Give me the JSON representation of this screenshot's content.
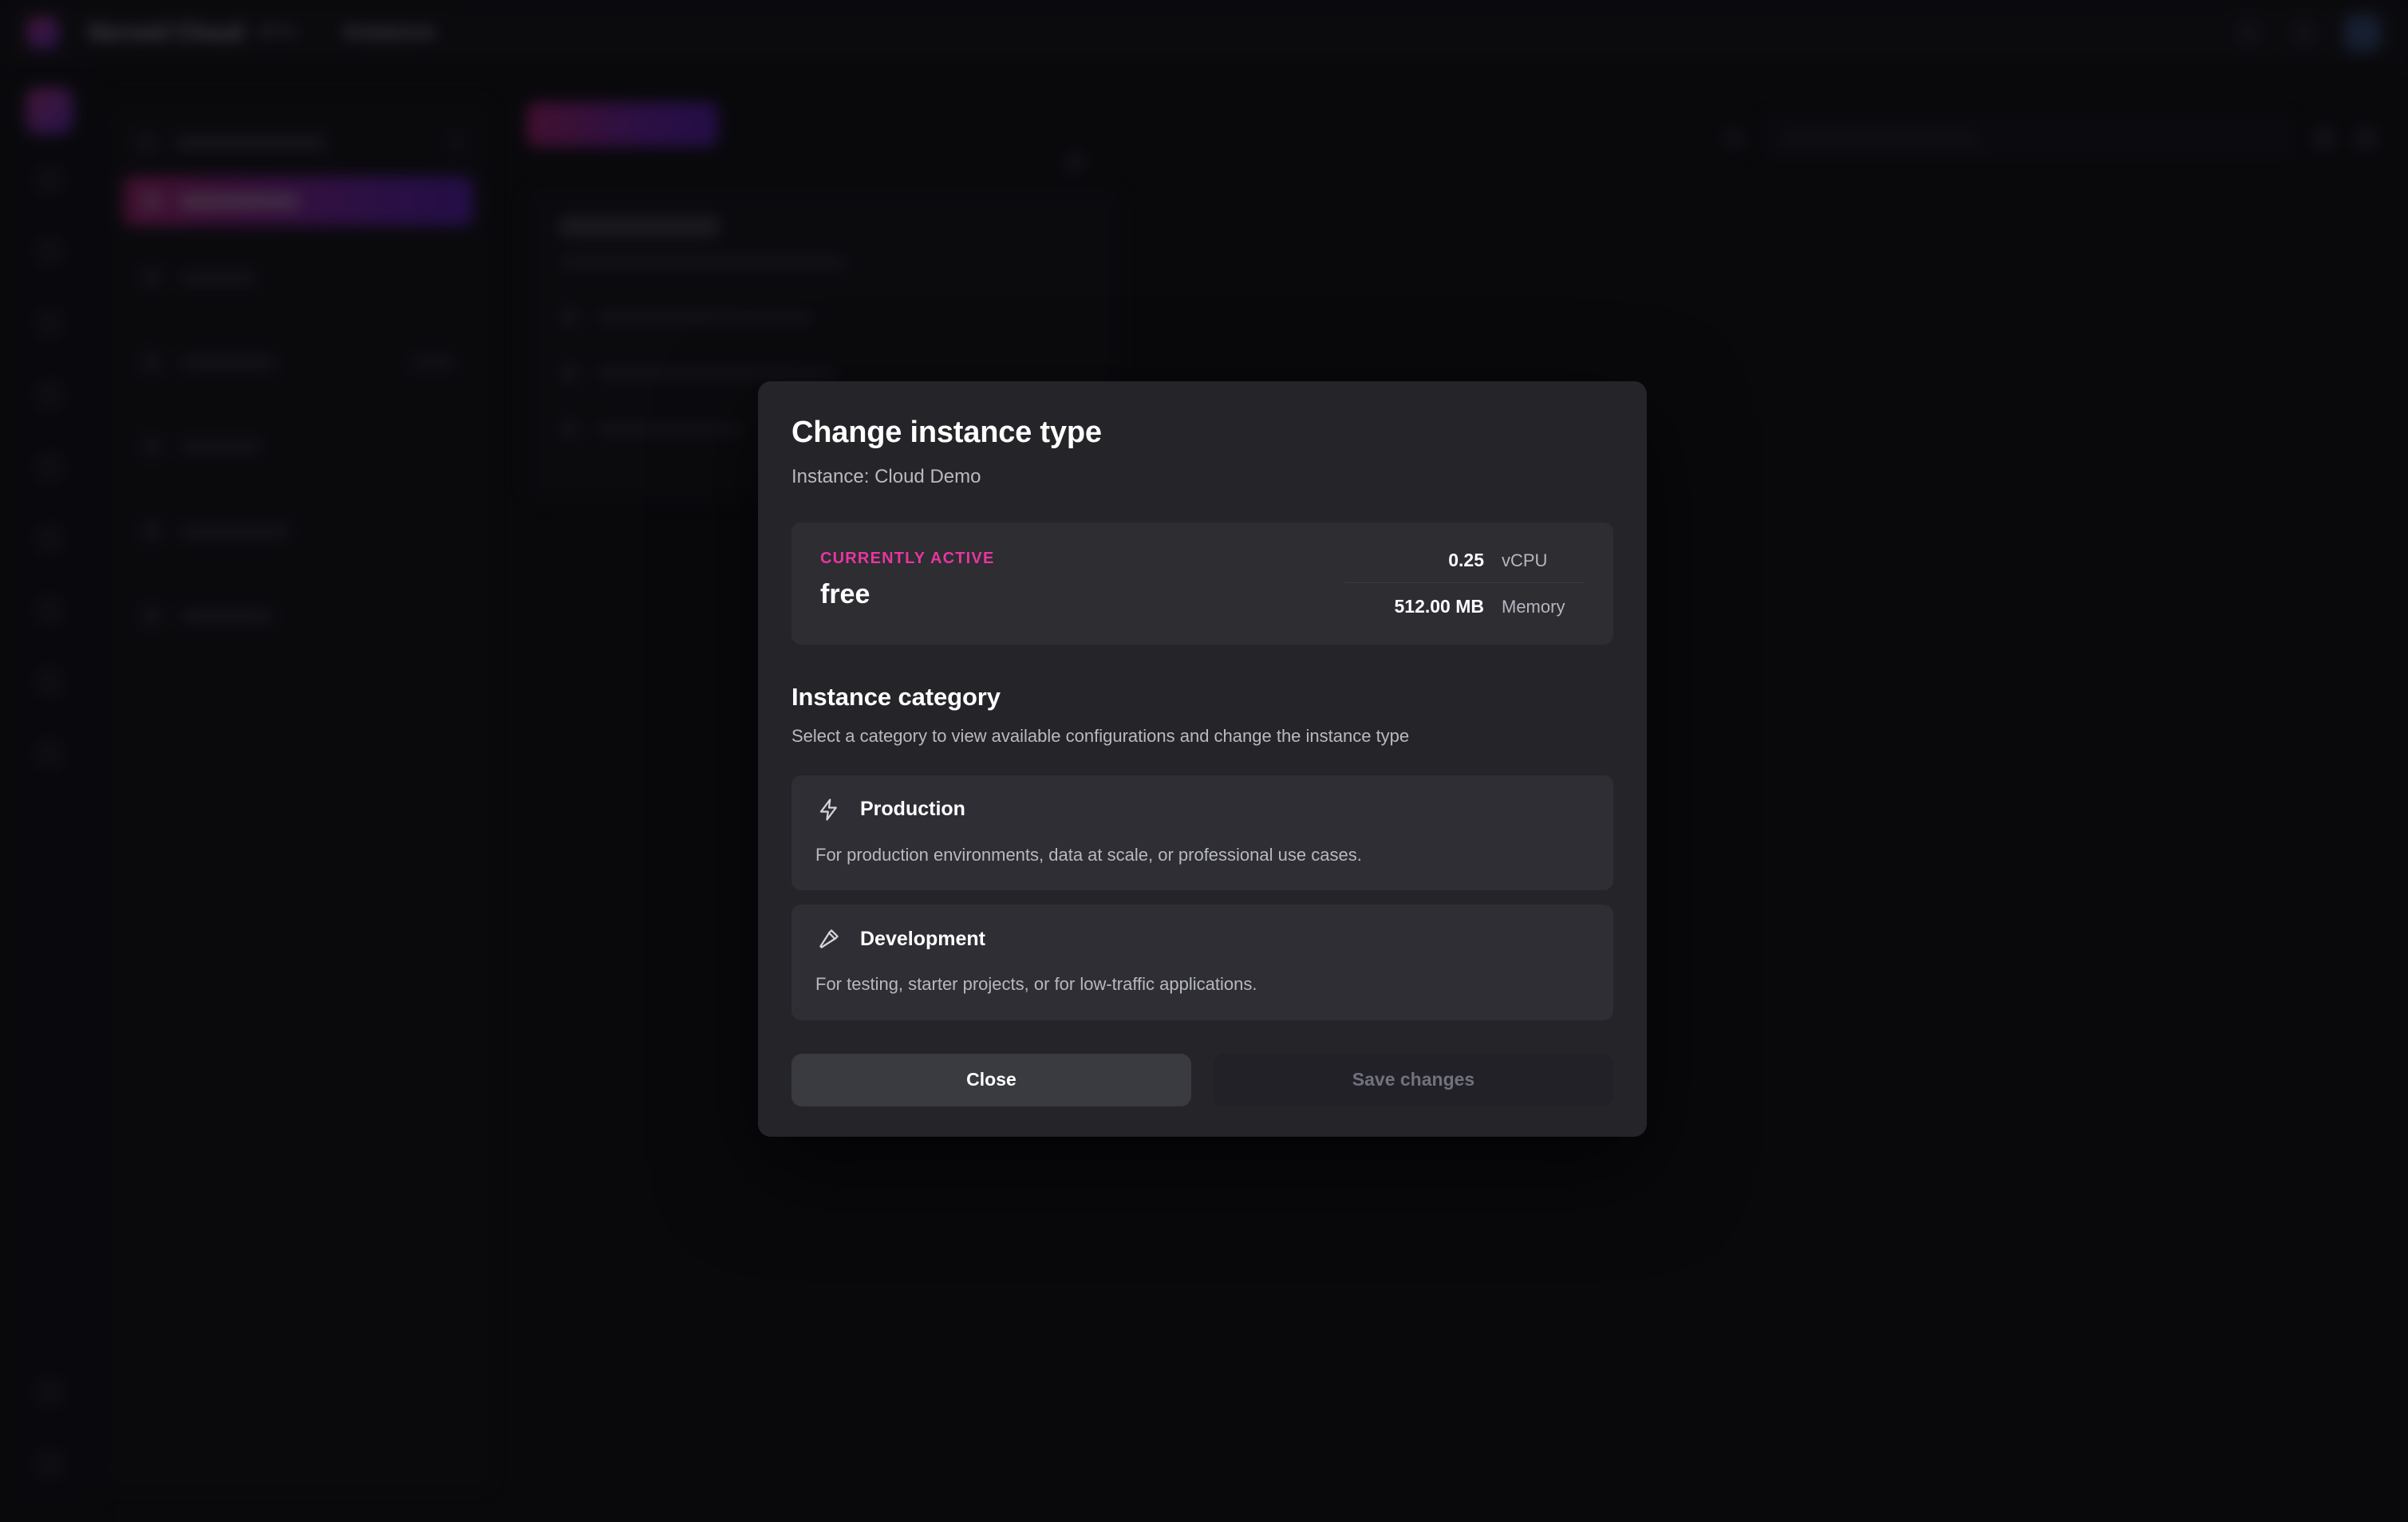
{
  "app": {
    "brand_name": "Served Cloud",
    "brand_badge": "BETA",
    "breadcrumb_current": "Instances"
  },
  "sidebar_rail": {
    "logo": "workspace-logo",
    "icons": [
      "home-icon",
      "grid-icon",
      "database-icon",
      "layers-icon",
      "shield-icon",
      "key-icon",
      "server-icon",
      "chart-icon",
      "bell-icon"
    ],
    "bottom_icons": [
      "help-icon",
      "settings-icon"
    ]
  },
  "sidebar_panel": {
    "header_label": "Workspace",
    "items": [
      {
        "label": "Instances",
        "active": true,
        "badge": ""
      },
      {
        "label": "Billing",
        "active": false,
        "badge": ""
      },
      {
        "label": "Network",
        "active": false,
        "badge": "BETA"
      },
      {
        "label": "Logs",
        "active": false,
        "badge": ""
      },
      {
        "label": "Members",
        "active": false,
        "badge": ""
      },
      {
        "label": "Settings",
        "active": false,
        "badge": ""
      }
    ]
  },
  "toolbar": {
    "primary_button_label": "New instance",
    "search_placeholder": "Search instances",
    "search_value": "",
    "search_icon": "search-icon",
    "filter_icon": "filter-icon",
    "view_icon": "grid-view-icon"
  },
  "content": {
    "card_title": "Cloud Demo",
    "card_subtitle": "Running on shared infrastructure",
    "rows": [
      {
        "label": "High CPU instance"
      },
      {
        "label": "EMEA Endpoint Cluster"
      },
      {
        "label": "v10.4.202-2.12"
      }
    ],
    "menu_icon": "kebab-menu-icon"
  },
  "modal": {
    "title": "Change instance type",
    "subtitle": "Instance: Cloud Demo",
    "active_card": {
      "kicker": "CURRENTLY ACTIVE",
      "name": "free",
      "specs": [
        {
          "value": "0.25",
          "unit": "vCPU"
        },
        {
          "value": "512.00 MB",
          "unit": "Memory"
        }
      ]
    },
    "section": {
      "title": "Instance category",
      "subtitle": "Select a category to view available configurations and change the instance type"
    },
    "categories": [
      {
        "icon": "zap-icon",
        "name": "Production",
        "description": "For production environments, data at scale, or professional use cases."
      },
      {
        "icon": "hammer-icon",
        "name": "Development",
        "description": "For testing, starter projects, or for low-traffic applications."
      }
    ],
    "buttons": {
      "close_label": "Close",
      "save_label": "Save changes"
    }
  },
  "colors": {
    "accent_pink": "#e8369f",
    "gradient_start": "#d6258f",
    "gradient_end": "#6c1ee0",
    "modal_bg": "#252529",
    "card_bg": "#2d2d32",
    "page_bg": "#0b0b0e"
  }
}
